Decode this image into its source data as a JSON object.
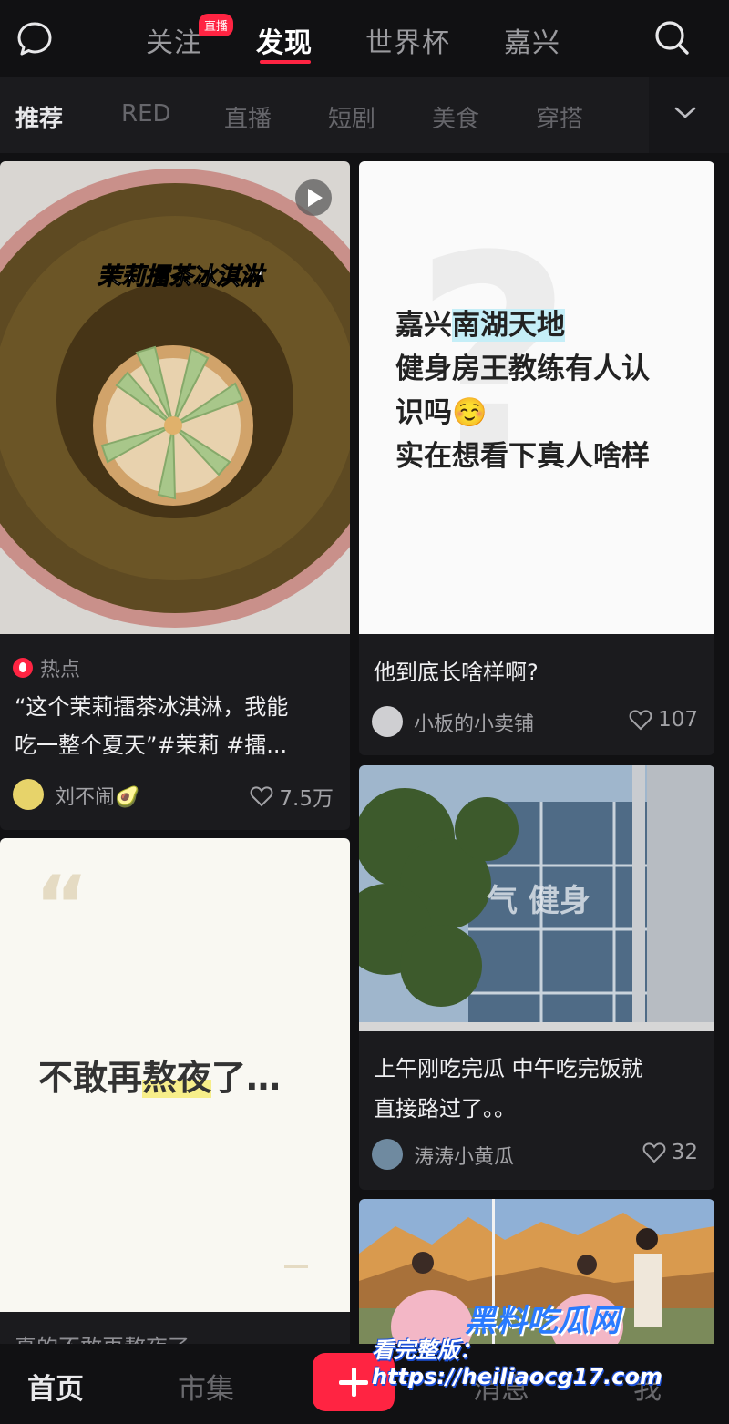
{
  "top_nav": {
    "tabs": [
      "关注",
      "发现",
      "世界杯",
      "嘉兴"
    ],
    "active_tab": "发现",
    "live_badge": "直播"
  },
  "categories": {
    "items": [
      "推荐",
      "RED",
      "直播",
      "短剧",
      "美食",
      "穿搭"
    ],
    "active": "推荐"
  },
  "feed": {
    "card1": {
      "cover_title": "茉莉擂茶冰淇淋",
      "tag": "热点",
      "text_line1": "“这个茉莉擂茶冰淇淋，我能",
      "text_line2": "吃一整个夏天”#茉莉 #擂...",
      "author": "刘不闹🥑",
      "likes": "7.5万"
    },
    "card2": {
      "cover_line1_pre": "嘉兴",
      "cover_line1_hl": "南湖天地",
      "cover_line2": "健身房王教练有人认",
      "cover_line3": "识吗☺️",
      "cover_line4": "实在想看下真人啥样",
      "title": "他到底长啥样啊?",
      "author": "小板的小卖铺",
      "likes": "107"
    },
    "card3": {
      "sign_text": "气 健身",
      "text_line1": "上午刚吃完瓜 中午吃完饭就",
      "text_line2": "直接路过了。。",
      "author": "涛涛小黄瓜",
      "likes": "32"
    },
    "card4": {
      "quote_mark": "“",
      "cover_text_pre": "不敢再",
      "cover_text_hl": "熬夜",
      "cover_text_post": "了…",
      "title_partial": "真的不敢再熬夜了"
    }
  },
  "bottom_nav": {
    "items": [
      "首页",
      "市集",
      "消息",
      "我"
    ],
    "active": "首页"
  },
  "watermark": {
    "line1": "黑料吃瓜网",
    "line2": "看完整版：https://heiliaocg17.com"
  },
  "colors": {
    "accent": "#ff2442",
    "background": "#111113",
    "card": "#1b1b1e"
  }
}
